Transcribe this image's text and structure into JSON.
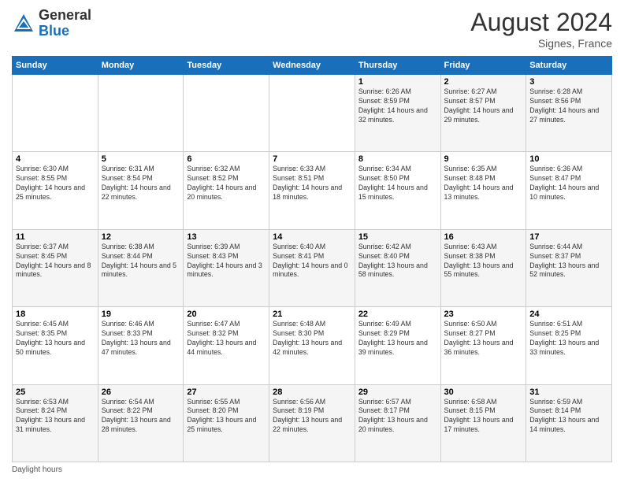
{
  "header": {
    "logo_general": "General",
    "logo_blue": "Blue",
    "month_year": "August 2024",
    "location": "Signes, France"
  },
  "days_of_week": [
    "Sunday",
    "Monday",
    "Tuesday",
    "Wednesday",
    "Thursday",
    "Friday",
    "Saturday"
  ],
  "weeks": [
    [
      {
        "day": "",
        "info": ""
      },
      {
        "day": "",
        "info": ""
      },
      {
        "day": "",
        "info": ""
      },
      {
        "day": "",
        "info": ""
      },
      {
        "day": "1",
        "info": "Sunrise: 6:26 AM\nSunset: 8:59 PM\nDaylight: 14 hours and 32 minutes."
      },
      {
        "day": "2",
        "info": "Sunrise: 6:27 AM\nSunset: 8:57 PM\nDaylight: 14 hours and 29 minutes."
      },
      {
        "day": "3",
        "info": "Sunrise: 6:28 AM\nSunset: 8:56 PM\nDaylight: 14 hours and 27 minutes."
      }
    ],
    [
      {
        "day": "4",
        "info": "Sunrise: 6:30 AM\nSunset: 8:55 PM\nDaylight: 14 hours and 25 minutes."
      },
      {
        "day": "5",
        "info": "Sunrise: 6:31 AM\nSunset: 8:54 PM\nDaylight: 14 hours and 22 minutes."
      },
      {
        "day": "6",
        "info": "Sunrise: 6:32 AM\nSunset: 8:52 PM\nDaylight: 14 hours and 20 minutes."
      },
      {
        "day": "7",
        "info": "Sunrise: 6:33 AM\nSunset: 8:51 PM\nDaylight: 14 hours and 18 minutes."
      },
      {
        "day": "8",
        "info": "Sunrise: 6:34 AM\nSunset: 8:50 PM\nDaylight: 14 hours and 15 minutes."
      },
      {
        "day": "9",
        "info": "Sunrise: 6:35 AM\nSunset: 8:48 PM\nDaylight: 14 hours and 13 minutes."
      },
      {
        "day": "10",
        "info": "Sunrise: 6:36 AM\nSunset: 8:47 PM\nDaylight: 14 hours and 10 minutes."
      }
    ],
    [
      {
        "day": "11",
        "info": "Sunrise: 6:37 AM\nSunset: 8:45 PM\nDaylight: 14 hours and 8 minutes."
      },
      {
        "day": "12",
        "info": "Sunrise: 6:38 AM\nSunset: 8:44 PM\nDaylight: 14 hours and 5 minutes."
      },
      {
        "day": "13",
        "info": "Sunrise: 6:39 AM\nSunset: 8:43 PM\nDaylight: 14 hours and 3 minutes."
      },
      {
        "day": "14",
        "info": "Sunrise: 6:40 AM\nSunset: 8:41 PM\nDaylight: 14 hours and 0 minutes."
      },
      {
        "day": "15",
        "info": "Sunrise: 6:42 AM\nSunset: 8:40 PM\nDaylight: 13 hours and 58 minutes."
      },
      {
        "day": "16",
        "info": "Sunrise: 6:43 AM\nSunset: 8:38 PM\nDaylight: 13 hours and 55 minutes."
      },
      {
        "day": "17",
        "info": "Sunrise: 6:44 AM\nSunset: 8:37 PM\nDaylight: 13 hours and 52 minutes."
      }
    ],
    [
      {
        "day": "18",
        "info": "Sunrise: 6:45 AM\nSunset: 8:35 PM\nDaylight: 13 hours and 50 minutes."
      },
      {
        "day": "19",
        "info": "Sunrise: 6:46 AM\nSunset: 8:33 PM\nDaylight: 13 hours and 47 minutes."
      },
      {
        "day": "20",
        "info": "Sunrise: 6:47 AM\nSunset: 8:32 PM\nDaylight: 13 hours and 44 minutes."
      },
      {
        "day": "21",
        "info": "Sunrise: 6:48 AM\nSunset: 8:30 PM\nDaylight: 13 hours and 42 minutes."
      },
      {
        "day": "22",
        "info": "Sunrise: 6:49 AM\nSunset: 8:29 PM\nDaylight: 13 hours and 39 minutes."
      },
      {
        "day": "23",
        "info": "Sunrise: 6:50 AM\nSunset: 8:27 PM\nDaylight: 13 hours and 36 minutes."
      },
      {
        "day": "24",
        "info": "Sunrise: 6:51 AM\nSunset: 8:25 PM\nDaylight: 13 hours and 33 minutes."
      }
    ],
    [
      {
        "day": "25",
        "info": "Sunrise: 6:53 AM\nSunset: 8:24 PM\nDaylight: 13 hours and 31 minutes."
      },
      {
        "day": "26",
        "info": "Sunrise: 6:54 AM\nSunset: 8:22 PM\nDaylight: 13 hours and 28 minutes."
      },
      {
        "day": "27",
        "info": "Sunrise: 6:55 AM\nSunset: 8:20 PM\nDaylight: 13 hours and 25 minutes."
      },
      {
        "day": "28",
        "info": "Sunrise: 6:56 AM\nSunset: 8:19 PM\nDaylight: 13 hours and 22 minutes."
      },
      {
        "day": "29",
        "info": "Sunrise: 6:57 AM\nSunset: 8:17 PM\nDaylight: 13 hours and 20 minutes."
      },
      {
        "day": "30",
        "info": "Sunrise: 6:58 AM\nSunset: 8:15 PM\nDaylight: 13 hours and 17 minutes."
      },
      {
        "day": "31",
        "info": "Sunrise: 6:59 AM\nSunset: 8:14 PM\nDaylight: 13 hours and 14 minutes."
      }
    ]
  ],
  "footer": {
    "note": "Daylight hours"
  }
}
